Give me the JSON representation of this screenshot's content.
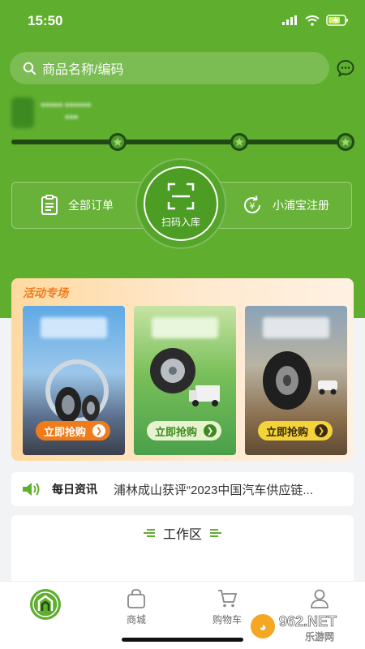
{
  "status_bar": {
    "time": "15:50"
  },
  "search": {
    "placeholder": "商品名称/编码"
  },
  "actions": {
    "orders_label": "全部订单",
    "scan_label": "扫码入库",
    "register_label": "小浦宝注册"
  },
  "activity": {
    "title": "活动专场",
    "promos": [
      {
        "button": "立即抢购",
        "theme": "blue"
      },
      {
        "button": "立即抢购",
        "theme": "green"
      },
      {
        "button": "立即抢购",
        "theme": "sand"
      }
    ]
  },
  "news": {
    "label": "每日资讯",
    "text": "浦林成山获评“2023中国汽车供应链..."
  },
  "workspace": {
    "title": "工作区"
  },
  "bottom_nav": {
    "items": [
      {
        "label": ""
      },
      {
        "label": "商城"
      },
      {
        "label": "购物车"
      },
      {
        "label": "我的"
      }
    ]
  },
  "watermark": {
    "text": "962.NET",
    "subtext": "乐游网"
  },
  "colors": {
    "brand_green": "#5fae2e",
    "accent_orange": "#f07b1b",
    "dark_green": "#1f4a16"
  }
}
